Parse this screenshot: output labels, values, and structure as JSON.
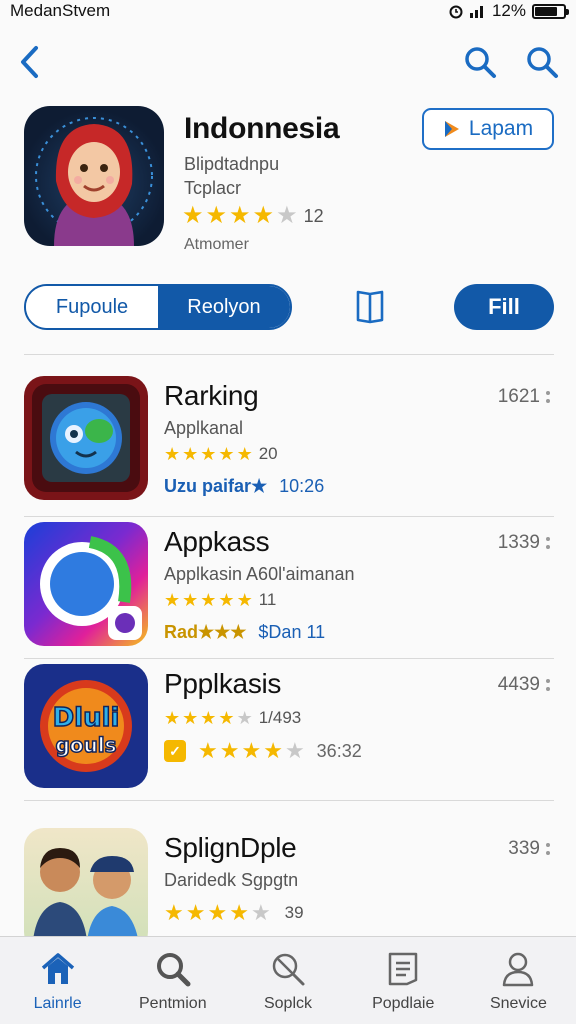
{
  "status_bar": {
    "carrier": "MedanSt‍vem",
    "battery": "12%",
    "battery_level": 0.8
  },
  "hero": {
    "title": "Indonnesia",
    "subtitle1": "Blipdtadnpu",
    "subtitle2": "Tcplacr",
    "rating_count": "12",
    "stars": 4,
    "meta": "Atmomer",
    "get_label": "Lapam"
  },
  "segments": [
    "Fupoule",
    "Reolyon"
  ],
  "fill_label": "Fill",
  "apps": [
    {
      "title": "Rarking",
      "subtitle": "Applkanal",
      "stars": 4.5,
      "rating_count": "20",
      "number": "1621",
      "extra_left": "Uzu paifar★",
      "extra_right": "10:26",
      "extra_color": "#1a5fb4"
    },
    {
      "title": "Appkass",
      "subtitle": "Applkasin A60l'aimanan",
      "stars": 4.5,
      "rating_count": "11",
      "number": "1339",
      "extra_left": "Rad★★★",
      "extra_right": "$Dan 11",
      "extra_color": "#c99400"
    },
    {
      "title": "Ppplkasis",
      "subtitle": "",
      "stars": 4,
      "rating_count": "1/493",
      "number": "4439",
      "extra_left": "★★★★",
      "extra_right": "36:32",
      "extra_color": "#666"
    },
    {
      "title": "SplignDple",
      "subtitle": "Daridedk Sgpgtn",
      "stars": 4,
      "rating_count": "39",
      "number": "339",
      "extra_left": "",
      "extra_right": "",
      "extra_color": "#666"
    }
  ],
  "tabs": [
    {
      "label": "Lainrle",
      "icon": "home-icon"
    },
    {
      "label": "Pentmion",
      "icon": "search-icon"
    },
    {
      "label": "Soplck",
      "icon": "search-slash-icon"
    },
    {
      "label": "Popdlaie",
      "icon": "document-icon"
    },
    {
      "label": "Snevice",
      "icon": "person-icon"
    }
  ],
  "colors": {
    "accent": "#1259a8",
    "star": "#f5b800",
    "link": "#1a6bc2"
  }
}
